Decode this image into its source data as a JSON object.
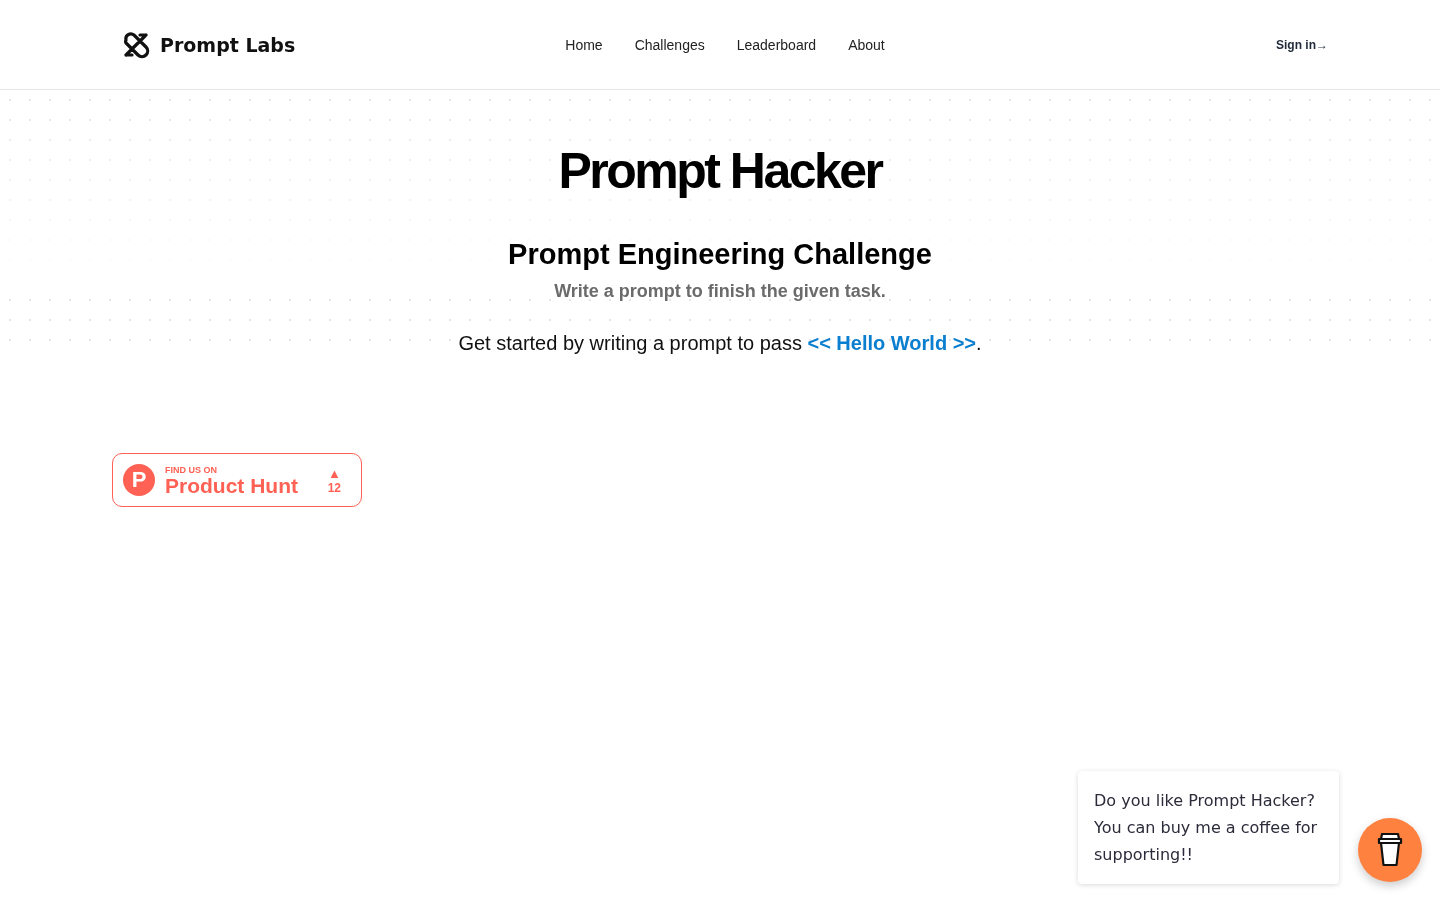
{
  "header": {
    "brand": "Prompt Labs",
    "nav": [
      "Home",
      "Challenges",
      "Leaderboard",
      "About"
    ],
    "sign_in": "Sign in→"
  },
  "hero": {
    "title": "Prompt Hacker",
    "subtitle": "Prompt Engineering Challenge",
    "tagline": "Write a prompt to finish the given task.",
    "intro": {
      "before": "Get started by writing a prompt to pass ",
      "link": "<< Hello World >>",
      "after": "."
    }
  },
  "product_hunt": {
    "logo": "P",
    "caption": "FIND US ON",
    "name": "Product Hunt",
    "arrow": "▲",
    "votes": "12"
  },
  "coffee_popup": {
    "message": "Do you like Prompt Hacker? You can buy me a coffee for supporting!!"
  }
}
